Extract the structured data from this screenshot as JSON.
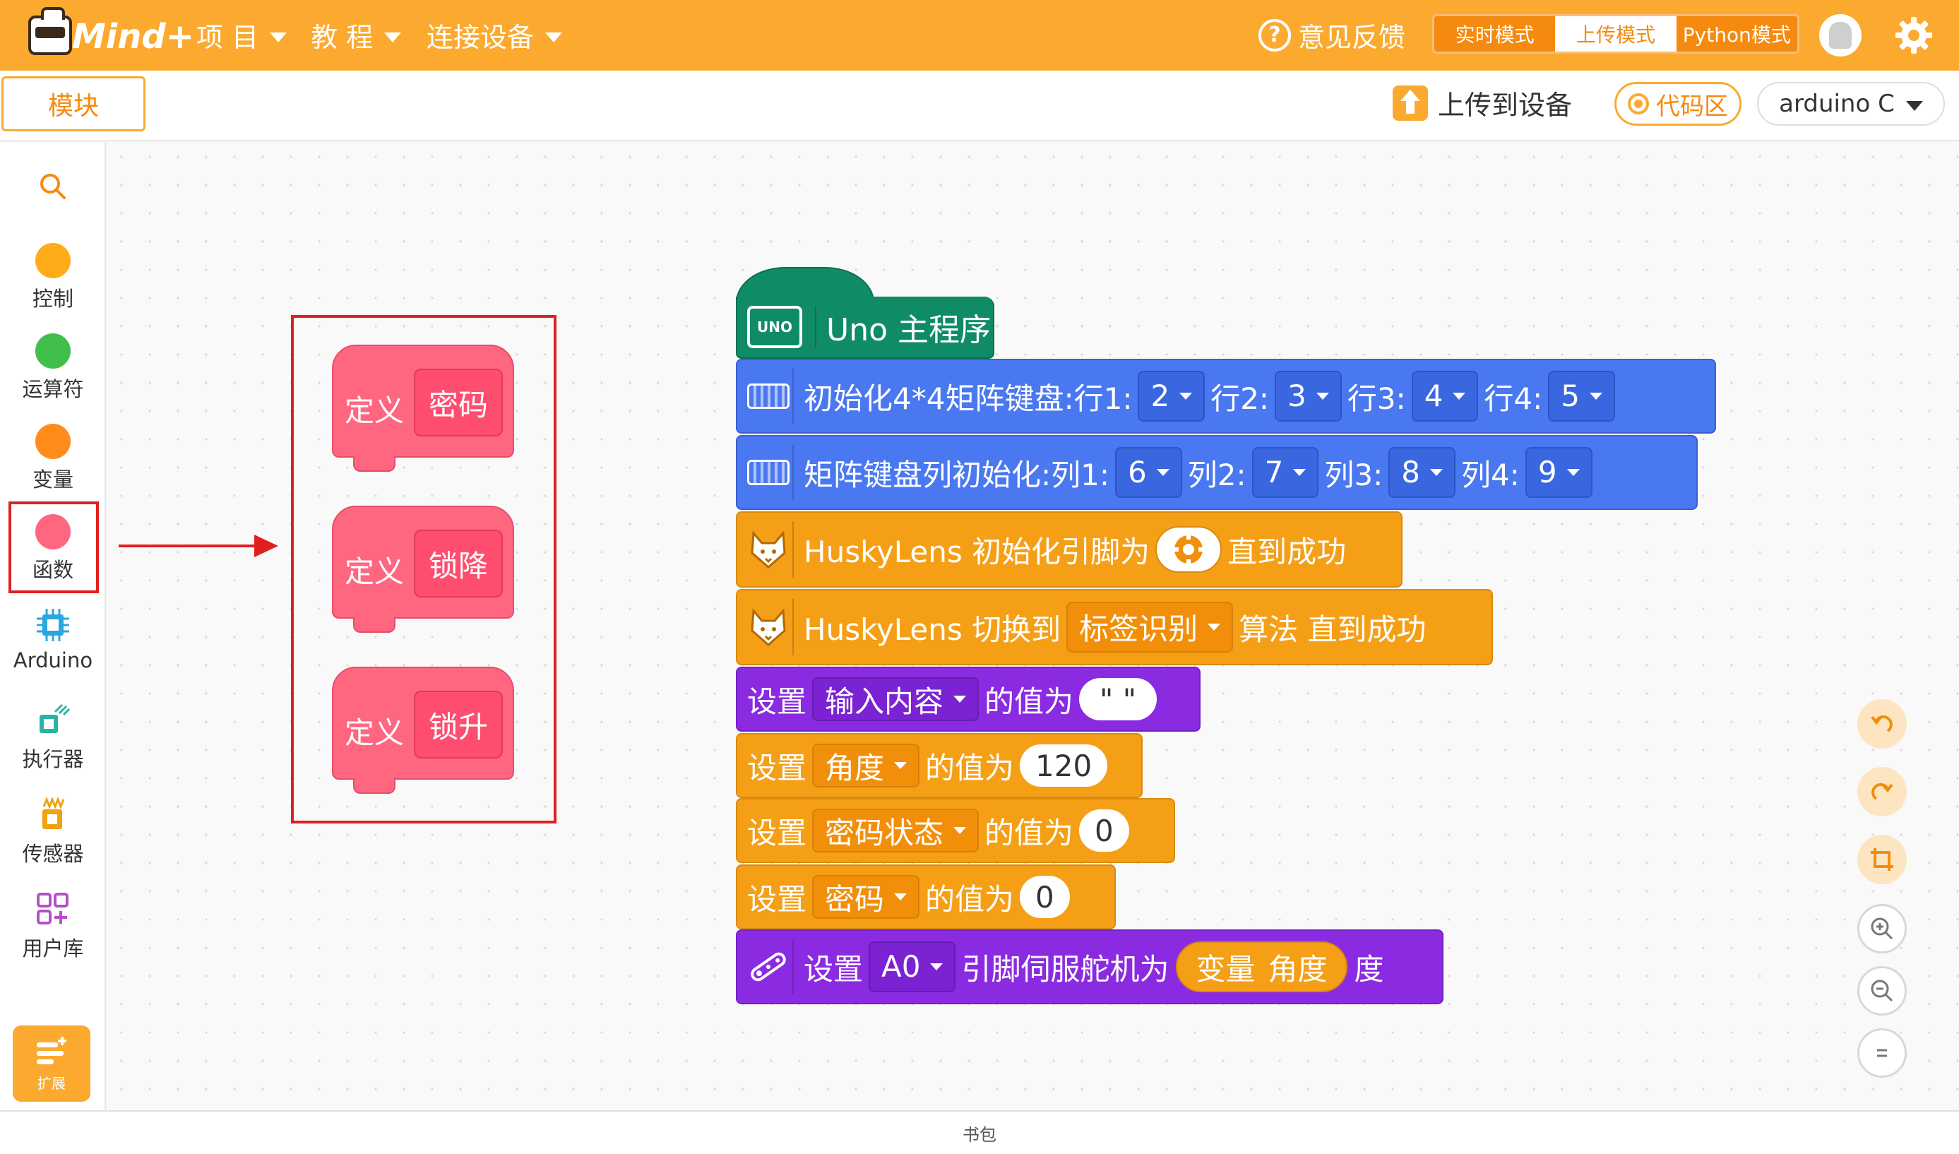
{
  "app": {
    "brand": "Mind+"
  },
  "menu": [
    {
      "label": "项 目"
    },
    {
      "label": "教 程"
    },
    {
      "label": "连接设备"
    }
  ],
  "feedback": {
    "label": "意见反馈"
  },
  "modes": {
    "realtime": "实时模式",
    "upload": "上传模式",
    "python": "Python模式",
    "active": "upload"
  },
  "subbar": {
    "tab_blocks": "模块",
    "upload_label": "上传到设备",
    "code_area": "代码区",
    "language": "arduino C"
  },
  "categories": [
    {
      "id": "search",
      "label": "",
      "icon": "search-icon"
    },
    {
      "id": "control",
      "label": "控制",
      "color": "#ffab19"
    },
    {
      "id": "operators",
      "label": "运算符",
      "color": "#40bf4a"
    },
    {
      "id": "variables",
      "label": "变量",
      "color": "#ff8c1a"
    },
    {
      "id": "functions",
      "label": "函数",
      "color": "#ff6680",
      "selected": true
    },
    {
      "id": "arduino",
      "label": "Arduino",
      "icon": "chip-icon"
    },
    {
      "id": "actuators",
      "label": "执行器",
      "icon": "actuator-icon"
    },
    {
      "id": "sensors",
      "label": "传感器",
      "icon": "sensor-icon"
    },
    {
      "id": "user_lib",
      "label": "用户库",
      "icon": "user-library-icon"
    }
  ],
  "extension": {
    "label": "扩展"
  },
  "definitions": [
    {
      "keyword": "定义",
      "name": "密码"
    },
    {
      "keyword": "定义",
      "name": "锁降"
    },
    {
      "keyword": "定义",
      "name": "锁升"
    }
  ],
  "program": {
    "hat": {
      "title": "Uno 主程序",
      "icon_text": "UNO"
    },
    "keypad_rows": {
      "label": "初始化4*4矩阵键盘:行1:",
      "v1": "2",
      "l2": "行2:",
      "v2": "3",
      "l3": "行3:",
      "v3": "4",
      "l4": "行4:",
      "v4": "5"
    },
    "keypad_cols": {
      "label": "矩阵键盘列初始化:列1:",
      "v1": "6",
      "l2": "列2:",
      "v2": "7",
      "l3": "列3:",
      "v3": "8",
      "l4": "列4:",
      "v4": "9"
    },
    "husky_init": {
      "label": "HuskyLens 初始化引脚为",
      "suffix": "直到成功"
    },
    "husky_switch": {
      "label": "HuskyLens 切换到",
      "algo": "标签识别",
      "suffix": "算法 直到成功"
    },
    "set_input": {
      "set": "设置",
      "var": "输入内容",
      "mid": "的值为",
      "value": "\" \""
    },
    "set_angle": {
      "set": "设置",
      "var": "角度",
      "mid": "的值为",
      "value": "120"
    },
    "set_state": {
      "set": "设置",
      "var": "密码状态",
      "mid": "的值为",
      "value": "0"
    },
    "set_pwd": {
      "set": "设置",
      "var": "密码",
      "mid": "的值为",
      "value": "0"
    },
    "servo": {
      "set": "设置",
      "pin": "A0",
      "mid": "引脚伺服舵机为",
      "var_kw": "变量",
      "var_name": "角度",
      "unit": "度"
    }
  },
  "bottom": {
    "backpack": "书包"
  },
  "colors": {
    "topbar": "#fbaa2f",
    "functions": "#ff6680",
    "arduino_hat": "#0f8c66",
    "keypad": "#4a78f0",
    "husky": "#f59f17",
    "purple": "#8a2be2"
  }
}
